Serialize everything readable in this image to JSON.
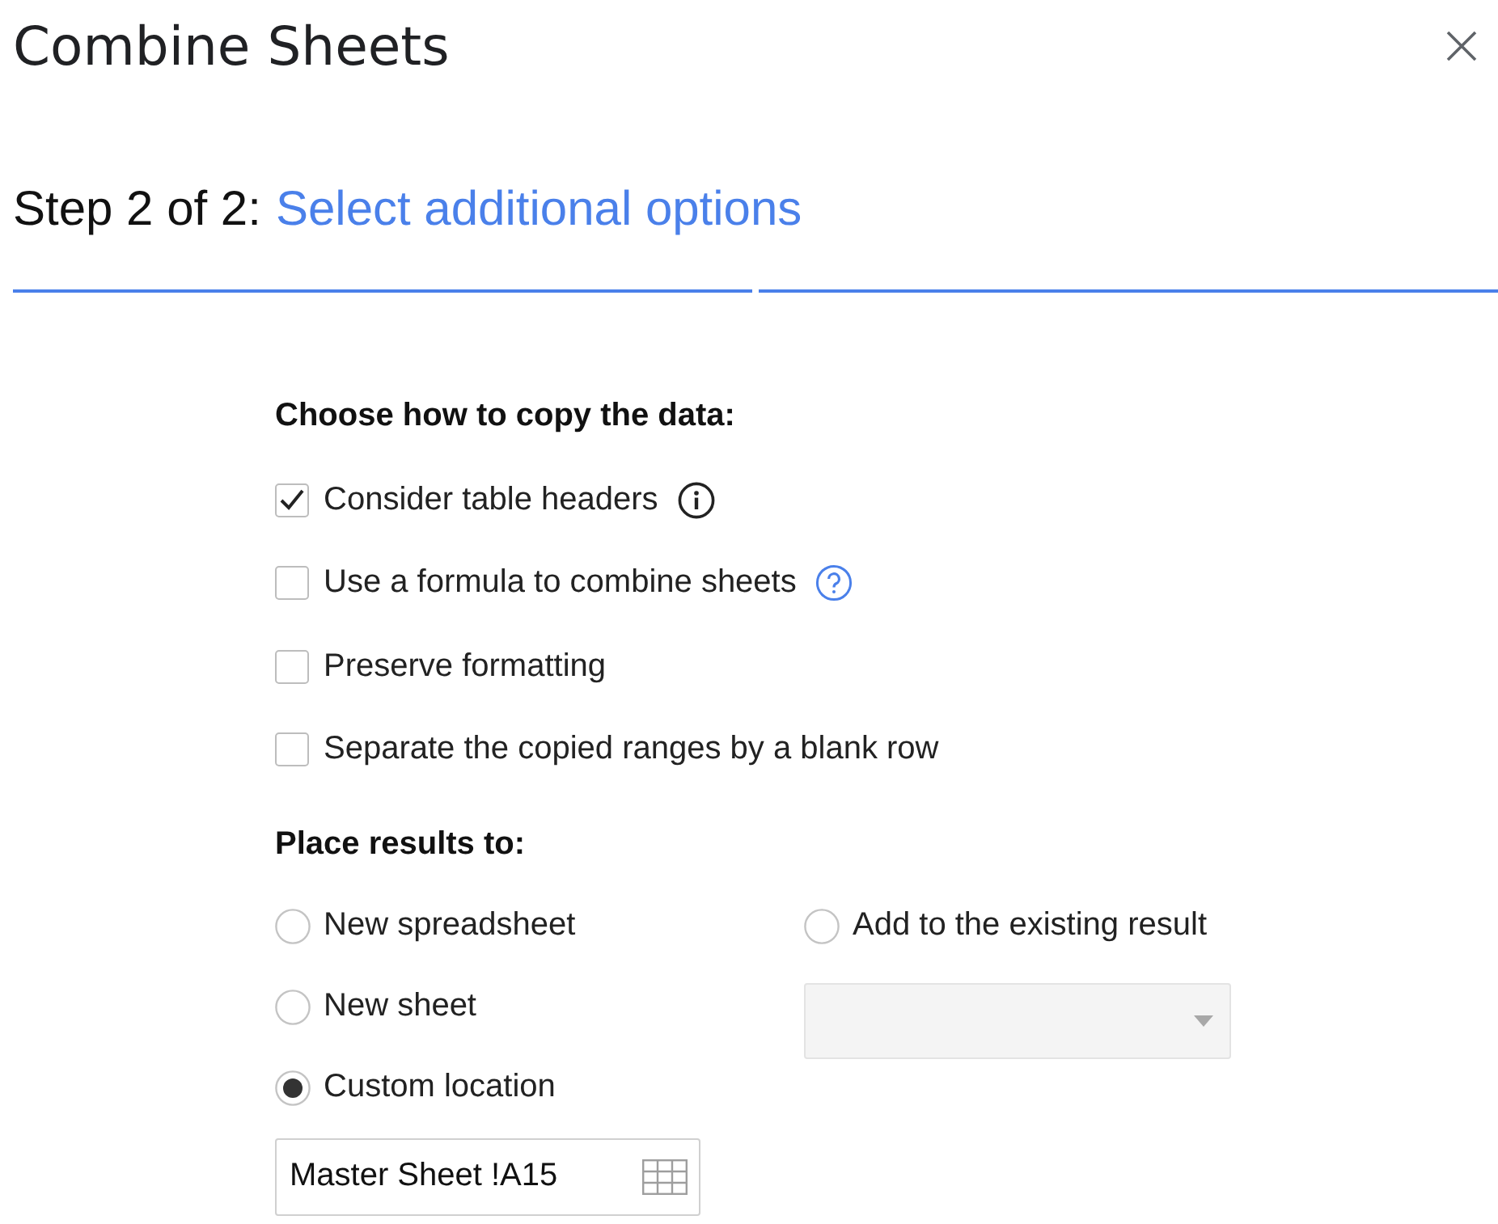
{
  "dialog": {
    "title": "Combine Sheets"
  },
  "step": {
    "counter": "Step 2 of 2:",
    "title": "Select additional options"
  },
  "progress": [
    {
      "done": true
    },
    {
      "done": true
    }
  ],
  "copy_options": {
    "heading": "Choose how to copy the data:",
    "items": [
      {
        "label": "Consider table headers",
        "checked": true,
        "kind": "info"
      },
      {
        "label": "Use a formula to combine sheets",
        "checked": false,
        "kind": "help"
      },
      {
        "label": "Preserve formatting",
        "checked": false,
        "kind": "plain"
      },
      {
        "label": "Separate the copied ranges by a blank row",
        "checked": false,
        "kind": "plain"
      }
    ]
  },
  "place_results": {
    "heading": "Place results to:",
    "left_options": [
      {
        "label": "New spreadsheet",
        "selected": false
      },
      {
        "label": "New sheet",
        "selected": false
      },
      {
        "label": "Custom location",
        "selected": true
      }
    ],
    "location_field": {
      "value": "Master Sheet !A15"
    },
    "right_options": [
      {
        "label": "Add to the existing result",
        "selected": false
      }
    ],
    "result_dropdown": {
      "disabled": true
    }
  }
}
